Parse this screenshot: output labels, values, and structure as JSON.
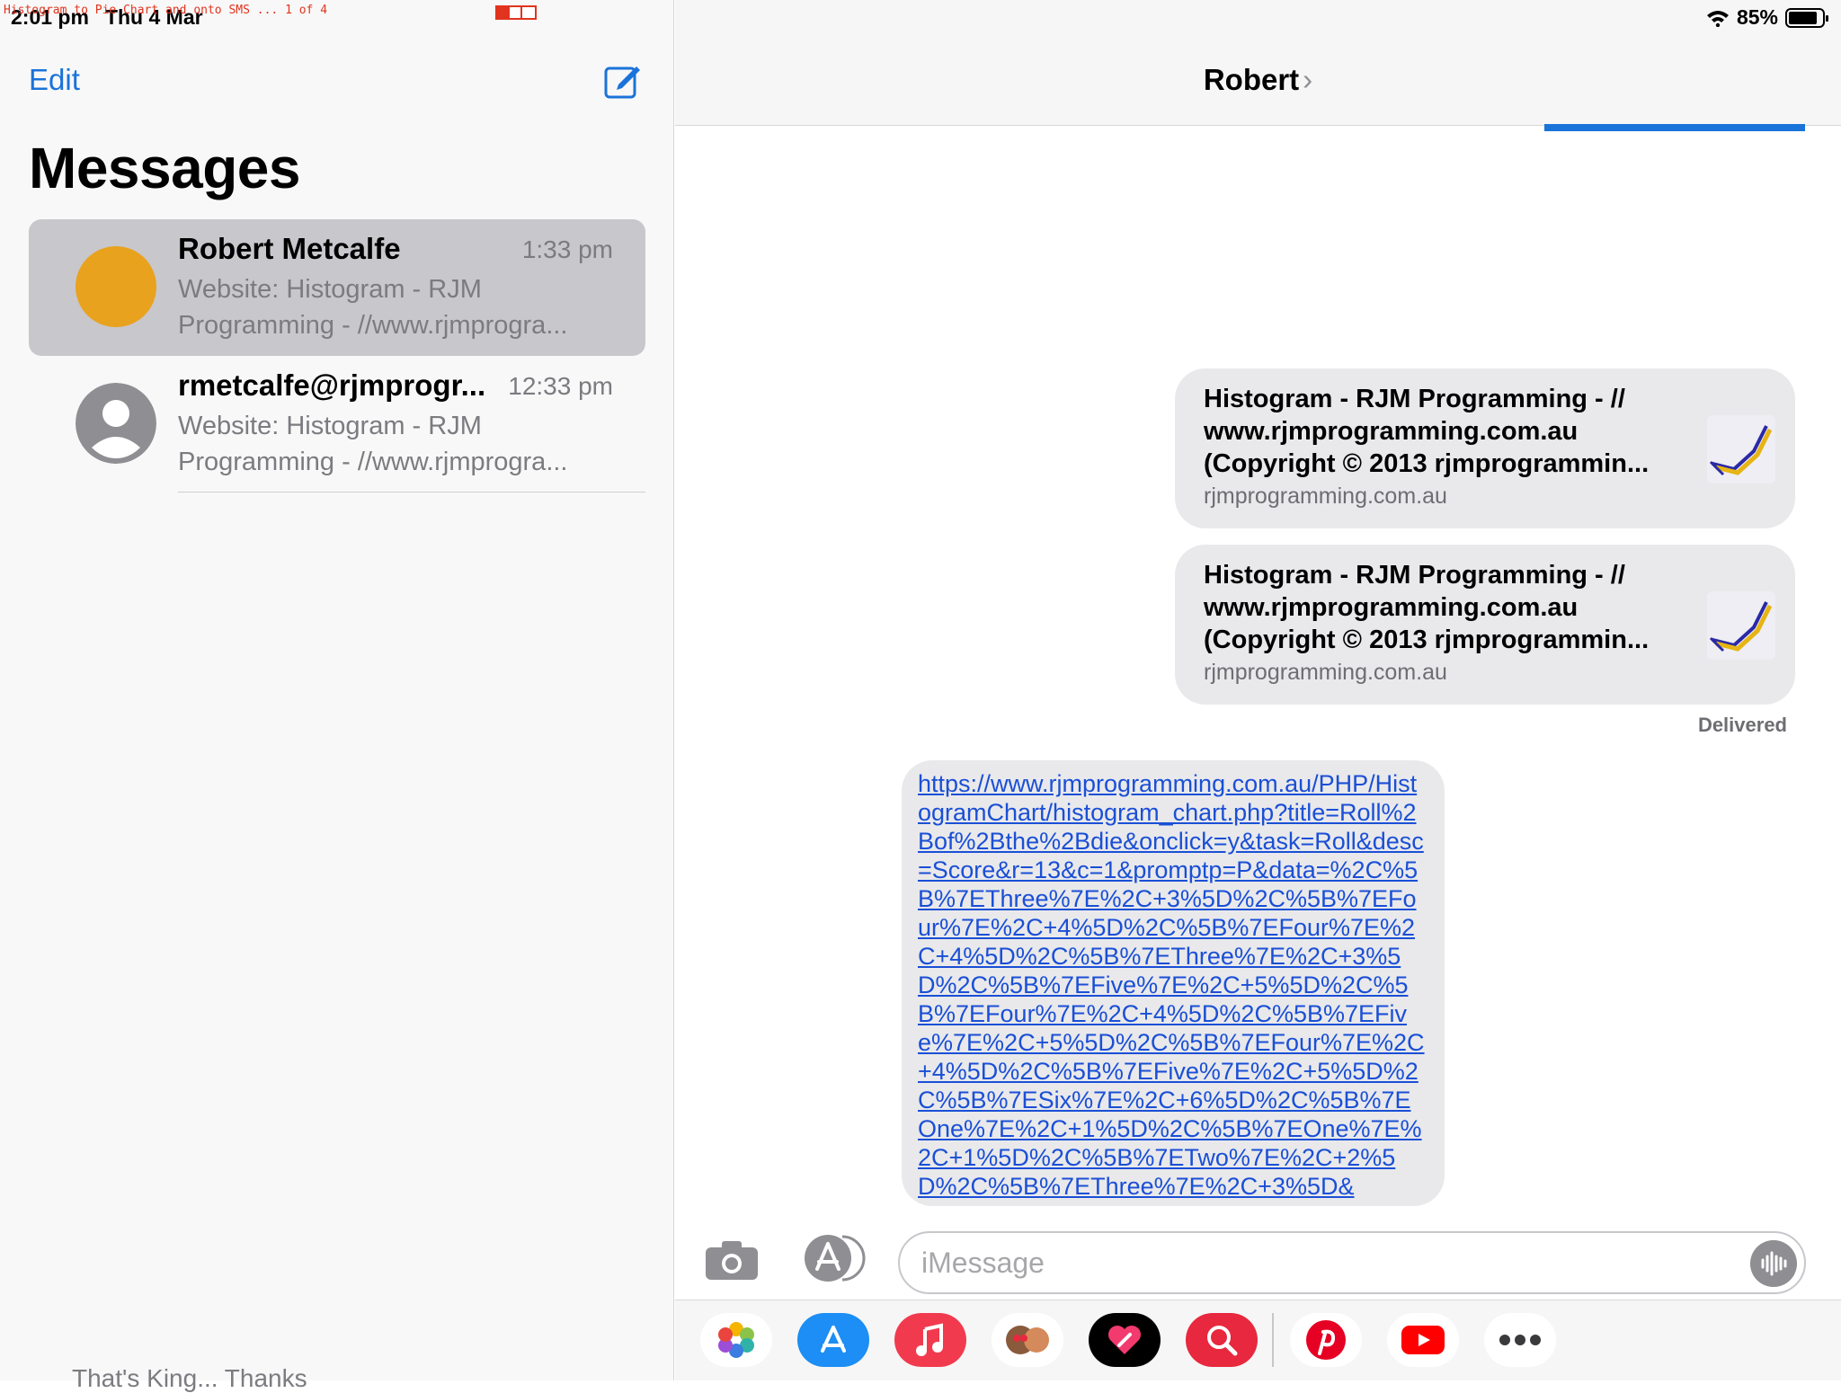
{
  "caption": {
    "text": "Histogram to Pie Chart and onto SMS ... 1 of 4"
  },
  "status": {
    "time": "2:01 pm",
    "date": "Thu 4 Mar",
    "battery": "85%"
  },
  "sidebar": {
    "edit_label": "Edit",
    "title": "Messages",
    "conversations": [
      {
        "name": "Robert Metcalfe",
        "time": "1:33 pm",
        "preview": "Website: Histogram - RJM Programming - //www.rjmprogra..."
      },
      {
        "name": "rmetcalfe@rjmprogr...",
        "time": "12:33 pm",
        "preview": "Website: Histogram - RJM Programming - //www.rjmprogra..."
      }
    ],
    "footer_text": "That's King... Thanks"
  },
  "thread": {
    "contact": "Robert",
    "chevron": "›",
    "link_previews": [
      {
        "title": "Histogram - RJM Programming - // www.rjmprogramming.com.au (Copyright © 2013 rjmprogrammin...",
        "site": "rjmprogramming.com.au"
      },
      {
        "title": "Histogram - RJM Programming - // www.rjmprogramming.com.au (Copyright © 2013 rjmprogrammin...",
        "site": "rjmprogramming.com.au"
      }
    ],
    "delivered": "Delivered",
    "url_message": "https://www.rjmprogramming.com.au/PHP/HistogramChart/histogram_chart.php?title=Roll%2Bof%2Bthe%2Bdie&onclick=y&task=Roll&desc=Score&r=13&c=1&promptp=P&data=%2C%5B%7EThree%7E%2C+3%5D%2C%5B%7EFour%7E%2C+4%5D%2C%5B%7EFour%7E%2C+4%5D%2C%5B%7EThree%7E%2C+3%5D%2C%5B%7EFive%7E%2C+5%5D%2C%5B%7EFour%7E%2C+4%5D%2C%5B%7EFive%7E%2C+5%5D%2C%5B%7EFour%7E%2C+4%5D%2C%5B%7EFive%7E%2C+5%5D%2C%5B%7ESix%7E%2C+6%5D%2C%5B%7EOne%7E%2C+1%5D%2C%5B%7EOne%7E%2C+1%5D%2C%5B%7ETwo%7E%2C+2%5D%2C%5B%7EThree%7E%2C+3%5D&"
  },
  "composer": {
    "placeholder": "iMessage"
  },
  "dock": {
    "apps": [
      {
        "name": "photos-app-icon",
        "color": "#ffffff"
      },
      {
        "name": "app-store-app-icon",
        "color": "#1c8ef5"
      },
      {
        "name": "music-app-icon",
        "color": "#f23a4e"
      },
      {
        "name": "memoji-app-icon",
        "color": "#ffffff"
      },
      {
        "name": "digital-touch-app-icon",
        "color": "#000000"
      },
      {
        "name": "images-search-app-icon",
        "color": "#e8283e"
      },
      {
        "name": "pinterest-app-icon",
        "color": "#ffffff"
      },
      {
        "name": "youtube-app-icon",
        "color": "#ffffff"
      },
      {
        "name": "more-apps-icon",
        "color": "#ffffff"
      }
    ]
  }
}
